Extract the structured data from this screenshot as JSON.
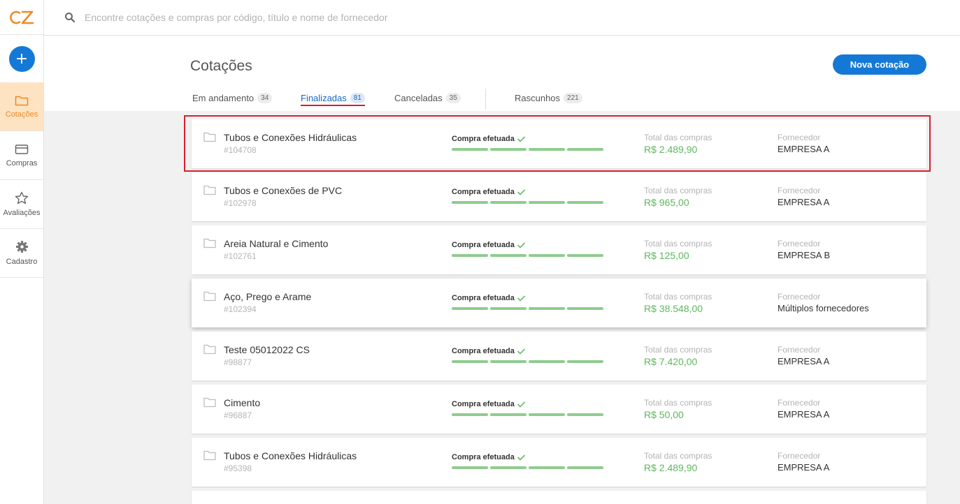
{
  "app": {
    "logo": "CZ"
  },
  "sidebar": {
    "add_label": "+",
    "items": [
      {
        "label": "Cotações",
        "icon": "folder-icon",
        "active": true
      },
      {
        "label": "Compras",
        "icon": "card-icon",
        "active": false
      },
      {
        "label": "Avaliações",
        "icon": "star-icon",
        "active": false
      },
      {
        "label": "Cadastro",
        "icon": "gear-icon",
        "active": false
      }
    ]
  },
  "search": {
    "placeholder": "Encontre cotações e compras por código, título e nome de fornecedor"
  },
  "header": {
    "title": "Cotações",
    "new_button": "Nova cotação",
    "tabs": [
      {
        "label": "Em andamento",
        "count": "34"
      },
      {
        "label": "Finalizadas",
        "count": "81"
      },
      {
        "label": "Canceladas",
        "count": "35"
      },
      {
        "label": "Rascunhos",
        "count": "221"
      }
    ]
  },
  "labels": {
    "status": "Compra efetuada",
    "total": "Total das compras",
    "supplier": "Fornecedor"
  },
  "quotes": [
    {
      "title": "Tubos e Conexões Hidráulicas",
      "id": "#104708",
      "total": "R$ 2.489,90",
      "supplier": "EMPRESA A"
    },
    {
      "title": "Tubos e Conexões de PVC",
      "id": "#102978",
      "total": "R$ 965,00",
      "supplier": "EMPRESA A"
    },
    {
      "title": "Areia Natural e Cimento",
      "id": "#102761",
      "total": "R$ 125,00",
      "supplier": "EMPRESA B"
    },
    {
      "title": "Aço, Prego e Arame",
      "id": "#102394",
      "total": "R$ 38.548,00",
      "supplier": "Múltiplos fornecedores"
    },
    {
      "title": "Teste 05012022 CS",
      "id": "#98877",
      "total": "R$ 7.420,00",
      "supplier": "EMPRESA A"
    },
    {
      "title": "Cimento",
      "id": "#96887",
      "total": "R$ 50,00",
      "supplier": "EMPRESA A"
    },
    {
      "title": "Tubos e Conexões Hidráulicas",
      "id": "#95398",
      "total": "R$ 2.489,90",
      "supplier": "EMPRESA A"
    }
  ],
  "colors": {
    "brand_orange": "#ee8a24",
    "primary_blue": "#1479d6",
    "success_green": "#5cb85c",
    "highlight_red": "#d62030"
  }
}
